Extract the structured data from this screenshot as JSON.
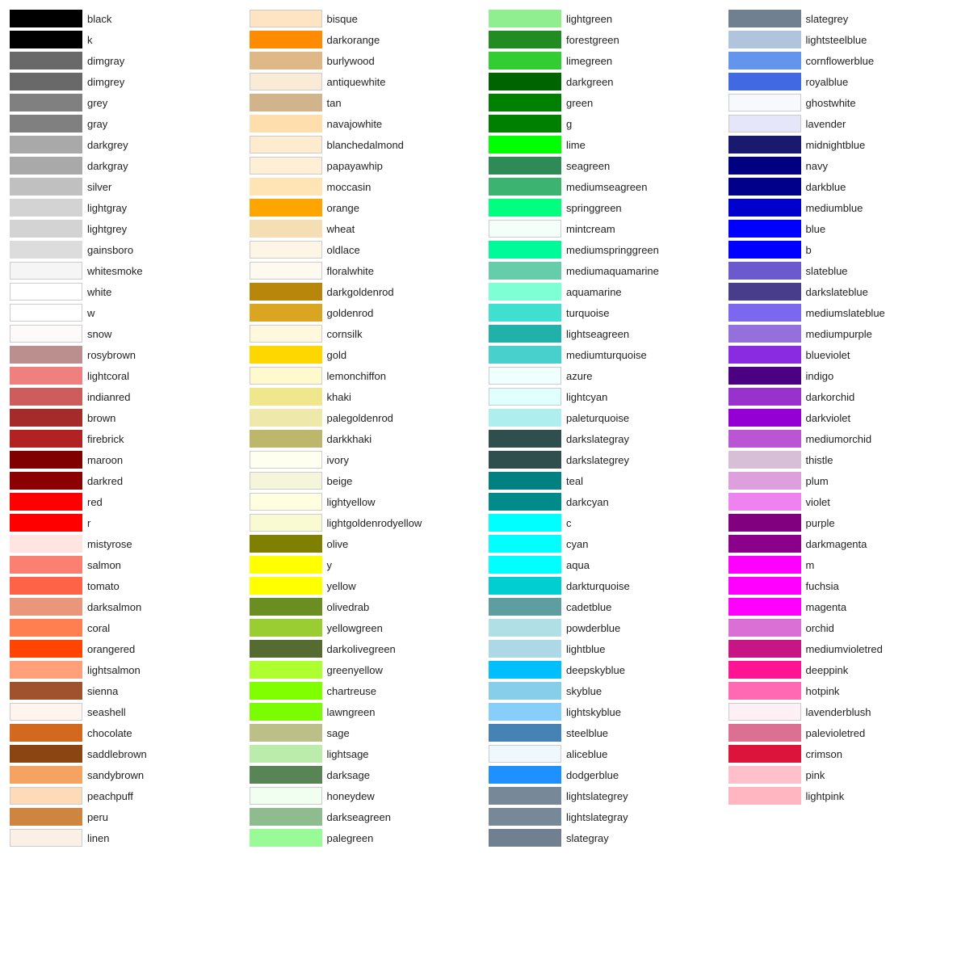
{
  "columns": [
    [
      {
        "name": "black",
        "color": "#000000"
      },
      {
        "name": "k",
        "color": "#000000"
      },
      {
        "name": "dimgray",
        "color": "#696969"
      },
      {
        "name": "dimgrey",
        "color": "#696969"
      },
      {
        "name": "grey",
        "color": "#808080"
      },
      {
        "name": "gray",
        "color": "#808080"
      },
      {
        "name": "darkgrey",
        "color": "#a9a9a9"
      },
      {
        "name": "darkgray",
        "color": "#a9a9a9"
      },
      {
        "name": "silver",
        "color": "#c0c0c0"
      },
      {
        "name": "lightgray",
        "color": "#d3d3d3"
      },
      {
        "name": "lightgrey",
        "color": "#d3d3d3"
      },
      {
        "name": "gainsboro",
        "color": "#dcdcdc"
      },
      {
        "name": "whitesmoke",
        "color": "#f5f5f5"
      },
      {
        "name": "white",
        "color": "#ffffff"
      },
      {
        "name": "w",
        "color": "#ffffff"
      },
      {
        "name": "snow",
        "color": "#fffafa"
      },
      {
        "name": "rosybrown",
        "color": "#bc8f8f"
      },
      {
        "name": "lightcoral",
        "color": "#f08080"
      },
      {
        "name": "indianred",
        "color": "#cd5c5c"
      },
      {
        "name": "brown",
        "color": "#a52a2a"
      },
      {
        "name": "firebrick",
        "color": "#b22222"
      },
      {
        "name": "maroon",
        "color": "#800000"
      },
      {
        "name": "darkred",
        "color": "#8b0000"
      },
      {
        "name": "red",
        "color": "#ff0000"
      },
      {
        "name": "r",
        "color": "#ff0000"
      },
      {
        "name": "mistyrose",
        "color": "#ffe4e1"
      },
      {
        "name": "salmon",
        "color": "#fa8072"
      },
      {
        "name": "tomato",
        "color": "#ff6347"
      },
      {
        "name": "darksalmon",
        "color": "#e9967a"
      },
      {
        "name": "coral",
        "color": "#ff7f50"
      },
      {
        "name": "orangered",
        "color": "#ff4500"
      },
      {
        "name": "lightsalmon",
        "color": "#ffa07a"
      },
      {
        "name": "sienna",
        "color": "#a0522d"
      },
      {
        "name": "seashell",
        "color": "#fff5ee"
      },
      {
        "name": "chocolate",
        "color": "#d2691e"
      },
      {
        "name": "saddlebrown",
        "color": "#8b4513"
      },
      {
        "name": "sandybrown",
        "color": "#f4a460"
      },
      {
        "name": "peachpuff",
        "color": "#ffdab9"
      },
      {
        "name": "peru",
        "color": "#cd853f"
      },
      {
        "name": "linen",
        "color": "#faf0e6"
      }
    ],
    [
      {
        "name": "bisque",
        "color": "#ffe4c4"
      },
      {
        "name": "darkorange",
        "color": "#ff8c00"
      },
      {
        "name": "burlywood",
        "color": "#deb887"
      },
      {
        "name": "antiquewhite",
        "color": "#faebd7"
      },
      {
        "name": "tan",
        "color": "#d2b48c"
      },
      {
        "name": "navajowhite",
        "color": "#ffdead"
      },
      {
        "name": "blanchedalmond",
        "color": "#ffebcd"
      },
      {
        "name": "papayawhip",
        "color": "#ffefd5"
      },
      {
        "name": "moccasin",
        "color": "#ffe4b5"
      },
      {
        "name": "orange",
        "color": "#ffa500"
      },
      {
        "name": "wheat",
        "color": "#f5deb3"
      },
      {
        "name": "oldlace",
        "color": "#fdf5e6"
      },
      {
        "name": "floralwhite",
        "color": "#fffaf0"
      },
      {
        "name": "darkgoldenrod",
        "color": "#b8860b"
      },
      {
        "name": "goldenrod",
        "color": "#daa520"
      },
      {
        "name": "cornsilk",
        "color": "#fff8dc"
      },
      {
        "name": "gold",
        "color": "#ffd700"
      },
      {
        "name": "lemonchiffon",
        "color": "#fffacd"
      },
      {
        "name": "khaki",
        "color": "#f0e68c"
      },
      {
        "name": "palegoldenrod",
        "color": "#eee8aa"
      },
      {
        "name": "darkkhaki",
        "color": "#bdb76b"
      },
      {
        "name": "ivory",
        "color": "#fffff0"
      },
      {
        "name": "beige",
        "color": "#f5f5dc"
      },
      {
        "name": "lightyellow",
        "color": "#ffffe0"
      },
      {
        "name": "lightgoldenrodyellow",
        "color": "#fafad2"
      },
      {
        "name": "olive",
        "color": "#808000"
      },
      {
        "name": "y",
        "color": "#ffff00"
      },
      {
        "name": "yellow",
        "color": "#ffff00"
      },
      {
        "name": "olivedrab",
        "color": "#6b8e23"
      },
      {
        "name": "yellowgreen",
        "color": "#9acd32"
      },
      {
        "name": "darkolivegreen",
        "color": "#556b2f"
      },
      {
        "name": "greenyellow",
        "color": "#adff2f"
      },
      {
        "name": "chartreuse",
        "color": "#7fff00"
      },
      {
        "name": "lawngreen",
        "color": "#7cfc00"
      },
      {
        "name": "sage",
        "color": "#bcbf87"
      },
      {
        "name": "lightsage",
        "color": "#bcecac"
      },
      {
        "name": "darksage",
        "color": "#598556"
      },
      {
        "name": "honeydew",
        "color": "#f0fff0"
      },
      {
        "name": "darkseagreen",
        "color": "#8fbc8f"
      },
      {
        "name": "palegreen",
        "color": "#98fb98"
      }
    ],
    [
      {
        "name": "lightgreen",
        "color": "#90ee90"
      },
      {
        "name": "forestgreen",
        "color": "#228b22"
      },
      {
        "name": "limegreen",
        "color": "#32cd32"
      },
      {
        "name": "darkgreen",
        "color": "#006400"
      },
      {
        "name": "green",
        "color": "#008000"
      },
      {
        "name": "g",
        "color": "#008000"
      },
      {
        "name": "lime",
        "color": "#00ff00"
      },
      {
        "name": "seagreen",
        "color": "#2e8b57"
      },
      {
        "name": "mediumseagreen",
        "color": "#3cb371"
      },
      {
        "name": "springgreen",
        "color": "#00ff7f"
      },
      {
        "name": "mintcream",
        "color": "#f5fffa"
      },
      {
        "name": "mediumspringgreen",
        "color": "#00fa9a"
      },
      {
        "name": "mediumaquamarine",
        "color": "#66cdaa"
      },
      {
        "name": "aquamarine",
        "color": "#7fffd4"
      },
      {
        "name": "turquoise",
        "color": "#40e0d0"
      },
      {
        "name": "lightseagreen",
        "color": "#20b2aa"
      },
      {
        "name": "mediumturquoise",
        "color": "#48d1cc"
      },
      {
        "name": "azure",
        "color": "#f0ffff"
      },
      {
        "name": "lightcyan",
        "color": "#e0ffff"
      },
      {
        "name": "paleturquoise",
        "color": "#afeeee"
      },
      {
        "name": "darkslategray",
        "color": "#2f4f4f"
      },
      {
        "name": "darkslategrey",
        "color": "#2f4f4f"
      },
      {
        "name": "teal",
        "color": "#008080"
      },
      {
        "name": "darkcyan",
        "color": "#008b8b"
      },
      {
        "name": "c",
        "color": "#00ffff"
      },
      {
        "name": "cyan",
        "color": "#00ffff"
      },
      {
        "name": "aqua",
        "color": "#00ffff"
      },
      {
        "name": "darkturquoise",
        "color": "#00ced1"
      },
      {
        "name": "cadetblue",
        "color": "#5f9ea0"
      },
      {
        "name": "powderblue",
        "color": "#b0e0e6"
      },
      {
        "name": "lightblue",
        "color": "#add8e6"
      },
      {
        "name": "deepskyblue",
        "color": "#00bfff"
      },
      {
        "name": "skyblue",
        "color": "#87ceeb"
      },
      {
        "name": "lightskyblue",
        "color": "#87cefa"
      },
      {
        "name": "steelblue",
        "color": "#4682b4"
      },
      {
        "name": "aliceblue",
        "color": "#f0f8ff"
      },
      {
        "name": "dodgerblue",
        "color": "#1e90ff"
      },
      {
        "name": "lightslategrey",
        "color": "#778899"
      },
      {
        "name": "lightslategray",
        "color": "#778899"
      },
      {
        "name": "slategray",
        "color": "#708090"
      }
    ],
    [
      {
        "name": "slategrey",
        "color": "#708090"
      },
      {
        "name": "lightsteelblue",
        "color": "#b0c4de"
      },
      {
        "name": "cornflowerblue",
        "color": "#6495ed"
      },
      {
        "name": "royalblue",
        "color": "#4169e1"
      },
      {
        "name": "ghostwhite",
        "color": "#f8f8ff"
      },
      {
        "name": "lavender",
        "color": "#e6e6fa"
      },
      {
        "name": "midnightblue",
        "color": "#191970"
      },
      {
        "name": "navy",
        "color": "#000080"
      },
      {
        "name": "darkblue",
        "color": "#00008b"
      },
      {
        "name": "mediumblue",
        "color": "#0000cd"
      },
      {
        "name": "blue",
        "color": "#0000ff"
      },
      {
        "name": "b",
        "color": "#0000ff"
      },
      {
        "name": "slateblue",
        "color": "#6a5acd"
      },
      {
        "name": "darkslateblue",
        "color": "#483d8b"
      },
      {
        "name": "mediumslateblue",
        "color": "#7b68ee"
      },
      {
        "name": "mediumpurple",
        "color": "#9370db"
      },
      {
        "name": "blueviolet",
        "color": "#8a2be2"
      },
      {
        "name": "indigo",
        "color": "#4b0082"
      },
      {
        "name": "darkorchid",
        "color": "#9932cc"
      },
      {
        "name": "darkviolet",
        "color": "#9400d3"
      },
      {
        "name": "mediumorchid",
        "color": "#ba55d3"
      },
      {
        "name": "thistle",
        "color": "#d8bfd8"
      },
      {
        "name": "plum",
        "color": "#dda0dd"
      },
      {
        "name": "violet",
        "color": "#ee82ee"
      },
      {
        "name": "purple",
        "color": "#800080"
      },
      {
        "name": "darkmagenta",
        "color": "#8b008b"
      },
      {
        "name": "m",
        "color": "#ff00ff"
      },
      {
        "name": "fuchsia",
        "color": "#ff00ff"
      },
      {
        "name": "magenta",
        "color": "#ff00ff"
      },
      {
        "name": "orchid",
        "color": "#da70d6"
      },
      {
        "name": "mediumvioletred",
        "color": "#c71585"
      },
      {
        "name": "deeppink",
        "color": "#ff1493"
      },
      {
        "name": "hotpink",
        "color": "#ff69b4"
      },
      {
        "name": "lavenderblush",
        "color": "#fff0f5"
      },
      {
        "name": "palevioletred",
        "color": "#db7093"
      },
      {
        "name": "crimson",
        "color": "#dc143c"
      },
      {
        "name": "pink",
        "color": "#ffc0cb"
      },
      {
        "name": "lightpink",
        "color": "#ffb6c1"
      }
    ]
  ]
}
